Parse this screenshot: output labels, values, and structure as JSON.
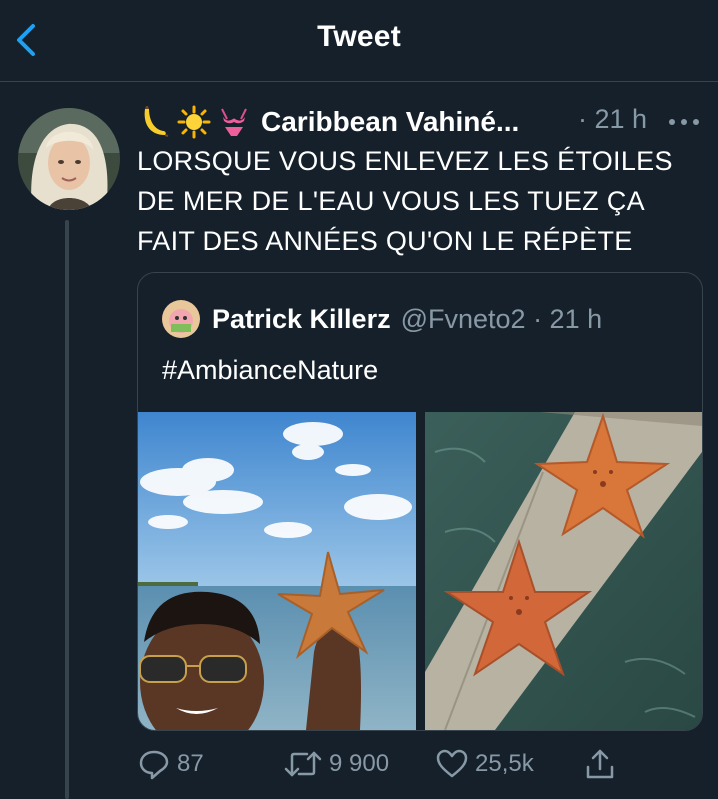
{
  "header": {
    "title": "Tweet",
    "back_icon": "chevron-left-icon"
  },
  "tweet": {
    "author": {
      "emojis": [
        "banana-icon",
        "sun-icon",
        "bikini-icon"
      ],
      "name": "Caribbean Vahiné..."
    },
    "time": "· 21 h",
    "more_icon": "more-horizontal-icon",
    "text_lines": [
      "LORSQUE VOUS ENLEVEZ LES ÉTOILES",
      "DE MER DE L'EAU VOUS LES TUEZ ÇA",
      "FAIT DES ANNÉES QU'ON LE RÉPÈTE"
    ]
  },
  "quote": {
    "name": "Patrick Killerz",
    "handle_time": "@Fvneto2 · 21 h",
    "text": "#AmbianceNature"
  },
  "actions": {
    "replies": {
      "icon": "reply-icon",
      "count": "87"
    },
    "retweets": {
      "icon": "retweet-icon",
      "count": "9 900"
    },
    "likes": {
      "icon": "heart-icon",
      "count": "25,5k"
    },
    "share": {
      "icon": "share-icon"
    }
  },
  "colors": {
    "background": "#15202b",
    "border": "#38444d",
    "secondary_text": "#8899a6",
    "accent": "#1da1f2"
  }
}
